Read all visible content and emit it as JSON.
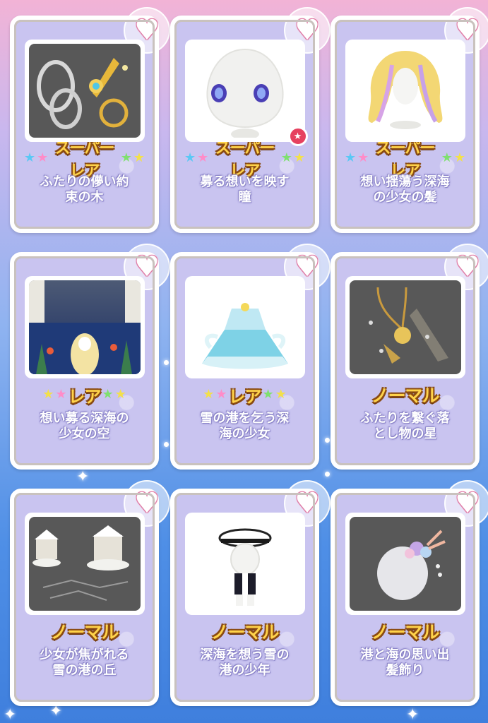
{
  "items": [
    {
      "rarity": "スーパーレア",
      "rarity_type": "super",
      "name_line1": "ふたりの儚い約",
      "name_line2": "束の木",
      "thumb": "dark",
      "icon": "chain-keys-icon"
    },
    {
      "rarity": "スーパーレア",
      "rarity_type": "super",
      "name_line1": "募る想いを映す",
      "name_line2": "瞳",
      "thumb": "light",
      "icon": "eyes-face-icon"
    },
    {
      "rarity": "スーパーレア",
      "rarity_type": "super",
      "name_line1": "想い揺蕩う深海",
      "name_line2": "の少女の髪",
      "thumb": "light",
      "icon": "golden-hair-icon"
    },
    {
      "rarity": "レア",
      "rarity_type": "rare",
      "name_line1": "想い募る深海の",
      "name_line2": "少女の空",
      "thumb": "sea",
      "icon": "seabed-scene-icon"
    },
    {
      "rarity": "レア",
      "rarity_type": "rare",
      "name_line1": "雪の港を乞う深",
      "name_line2": "海の少女",
      "thumb": "light",
      "icon": "blue-dress-icon"
    },
    {
      "rarity": "ノーマル",
      "rarity_type": "normal",
      "name_line1": "ふたりを繋ぐ落",
      "name_line2": "とし物の星",
      "thumb": "dark",
      "icon": "star-necklace-icon"
    },
    {
      "rarity": "ノーマル",
      "rarity_type": "normal",
      "name_line1": "少女が焦がれる",
      "name_line2": "雪の港の丘",
      "thumb": "dark",
      "icon": "snow-houses-icon"
    },
    {
      "rarity": "ノーマル",
      "rarity_type": "normal",
      "name_line1": "深海を想う雪の",
      "name_line2": "港の少年",
      "thumb": "light",
      "icon": "sailor-boy-icon"
    },
    {
      "rarity": "ノーマル",
      "rarity_type": "normal",
      "name_line1": "港と海の思い出",
      "name_line2": "髪飾り",
      "thumb": "dark",
      "icon": "flower-hairpiece-icon"
    }
  ],
  "colors": {
    "rarity_text": "#ffd34a",
    "rarity_outline": "#8a4b13",
    "card_bg": "#c9c4f0",
    "heart_outline": "#e07ca6"
  }
}
